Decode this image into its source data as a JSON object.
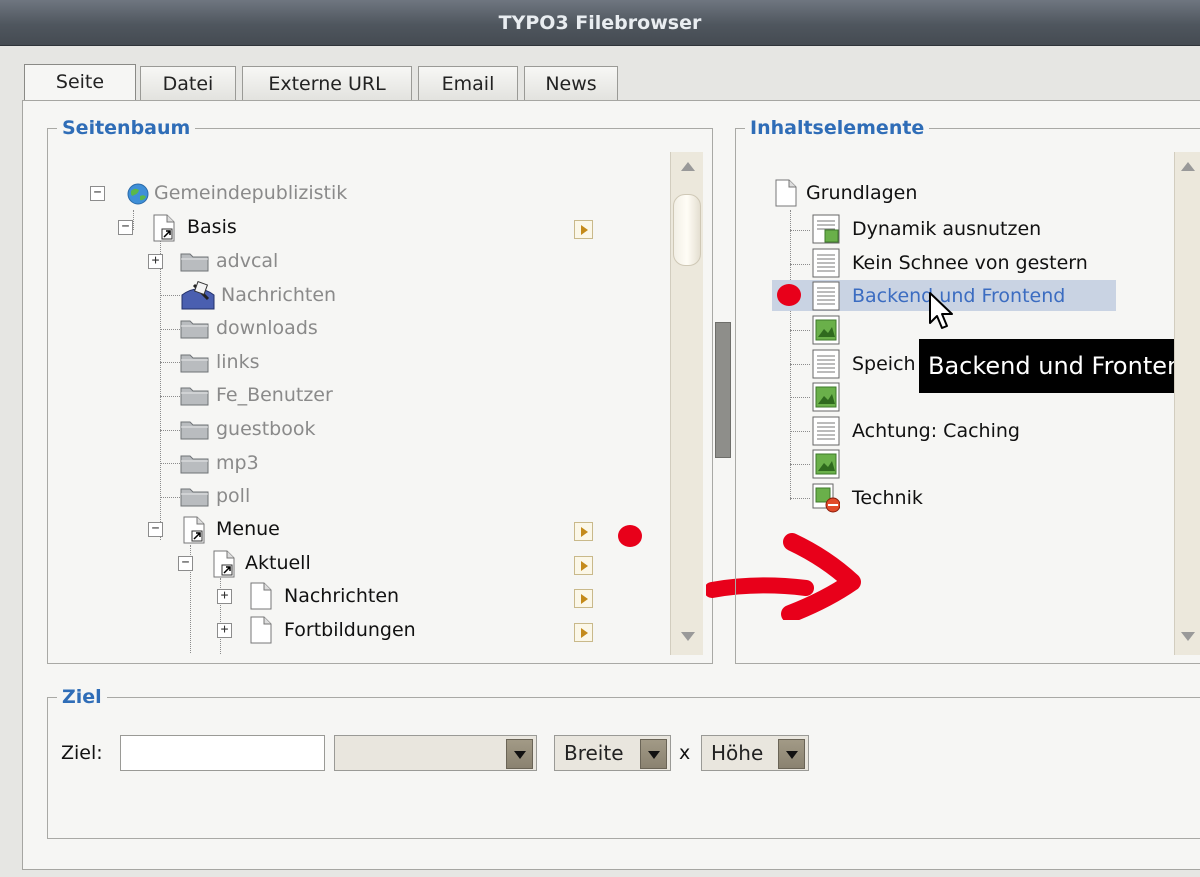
{
  "window": {
    "title": "TYPO3 Filebrowser"
  },
  "tabs": [
    {
      "label": "Seite",
      "active": true
    },
    {
      "label": "Datei"
    },
    {
      "label": "Externe URL"
    },
    {
      "label": "Email"
    },
    {
      "label": "News"
    }
  ],
  "seitenbaum": {
    "legend": "Seitenbaum",
    "nodes": [
      {
        "label": "Gemeindepublizistik",
        "icon": "globe-icon"
      },
      {
        "label": "Basis",
        "icon": "page-shortcut-icon"
      },
      {
        "label": "advcal",
        "icon": "folder-icon"
      },
      {
        "label": "Nachrichten",
        "icon": "news-sysfolder-icon"
      },
      {
        "label": "downloads",
        "icon": "folder-icon"
      },
      {
        "label": "links",
        "icon": "folder-icon"
      },
      {
        "label": "Fe_Benutzer",
        "icon": "folder-icon"
      },
      {
        "label": "guestbook",
        "icon": "folder-icon"
      },
      {
        "label": "mp3",
        "icon": "folder-icon"
      },
      {
        "label": "poll",
        "icon": "folder-icon"
      },
      {
        "label": "Menue",
        "icon": "page-shortcut-icon"
      },
      {
        "label": "Aktuell",
        "icon": "page-shortcut-icon"
      },
      {
        "label": "Nachrichten",
        "icon": "page-icon"
      },
      {
        "label": "Fortbildungen",
        "icon": "page-icon"
      }
    ]
  },
  "inhaltselemente": {
    "legend": "Inhaltselemente",
    "root": "Grundlagen",
    "items": [
      {
        "label": "Dynamik ausnutzen",
        "icon": "text-image-icon"
      },
      {
        "label": "Kein Schnee von gestern",
        "icon": "text-icon"
      },
      {
        "label": "Backend und Frontend",
        "icon": "text-icon",
        "selected": true
      },
      {
        "label": "",
        "icon": "image-icon"
      },
      {
        "label": "Speich",
        "icon": "text-icon"
      },
      {
        "label": "",
        "icon": "image-icon"
      },
      {
        "label": "Achtung: Caching",
        "icon": "text-icon"
      },
      {
        "label": "",
        "icon": "image-icon"
      },
      {
        "label": "Technik",
        "icon": "hidden-image-icon"
      }
    ],
    "tooltip": "Backend und Frontend"
  },
  "ziel": {
    "legend": "Ziel",
    "label": "Ziel:",
    "target_value": "",
    "select_value": "",
    "breite": "Breite",
    "x": "x",
    "hoehe": "Höhe"
  },
  "colors": {
    "legend": "#2f6db7",
    "annotation": "#e8001a",
    "selection": "#c9d3e3"
  }
}
